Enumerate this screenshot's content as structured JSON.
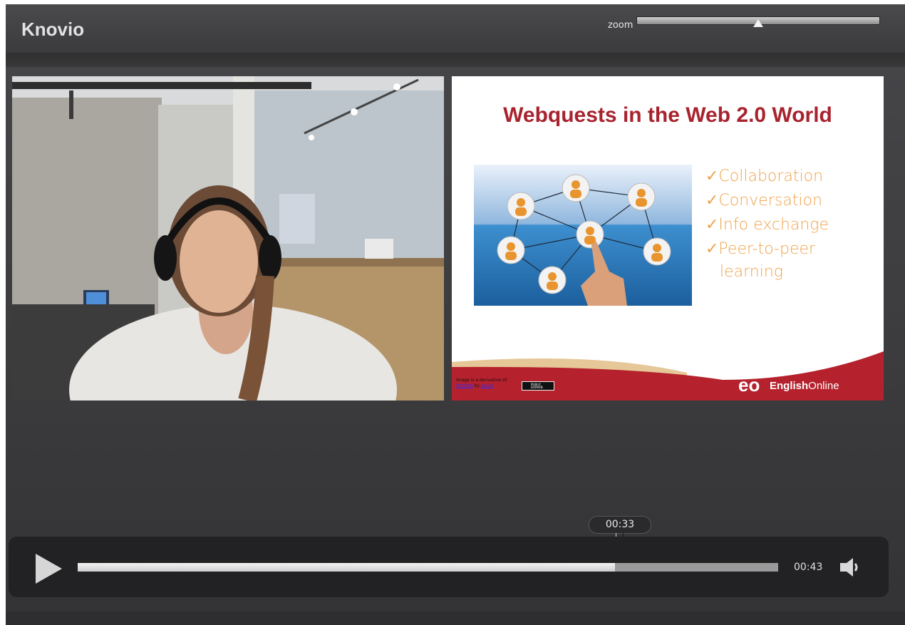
{
  "app": {
    "title": "Knovio"
  },
  "zoom": {
    "label": "zoom",
    "level": 0.5
  },
  "slide": {
    "title": "Webquests in the Web 2.0 World",
    "bullets": [
      "✓Collaboration",
      "✓Conversation",
      "✓Info exchange",
      "✓Peer-to-peer",
      "learning"
    ],
    "credit_line1": "Image is a derivative of:",
    "credit_link1": "Untitled",
    "credit_by": "by",
    "credit_link2": "geralt",
    "badge_text": "PUBLIC DOMAIN",
    "brand_logo": "eo",
    "brand_bold": "English",
    "brand_light": "Online"
  },
  "player": {
    "current_time": "00:33",
    "duration": "00:43",
    "progress": 0.767,
    "play_icon": "play-icon",
    "volume_icon": "volume-icon"
  },
  "colors": {
    "accent_red": "#a8232e",
    "bullet_orange": "#f0a24a",
    "footer_red": "#b5222d"
  }
}
